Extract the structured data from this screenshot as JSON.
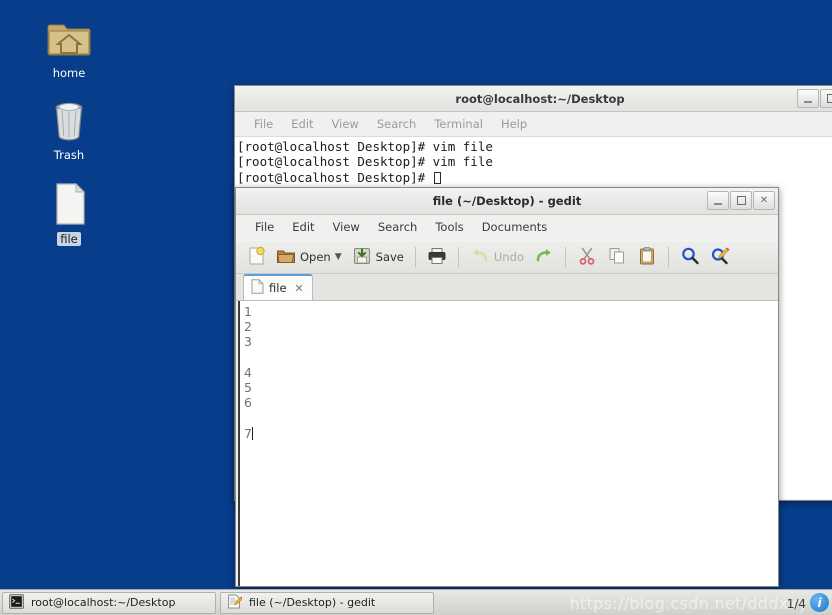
{
  "desktop": {
    "background_color": "#083d8c",
    "icons": [
      {
        "name": "home",
        "label": "home",
        "icon": "folder-home-icon",
        "selected": false
      },
      {
        "name": "trash",
        "label": "Trash",
        "icon": "trash-can-icon",
        "selected": false
      },
      {
        "name": "file",
        "label": "file",
        "icon": "text-file-icon",
        "selected": true
      }
    ]
  },
  "terminal": {
    "title": "root@localhost:~/Desktop",
    "menu": [
      "File",
      "Edit",
      "View",
      "Search",
      "Terminal",
      "Help"
    ],
    "window_buttons": [
      "minimize",
      "maximize"
    ],
    "lines": [
      "[root@localhost Desktop]# vim file",
      "[root@localhost Desktop]# vim file",
      "[root@localhost Desktop]# "
    ],
    "prompt_cursor": true
  },
  "gedit": {
    "title": "file (~/Desktop) - gedit",
    "menu": [
      "File",
      "Edit",
      "View",
      "Search",
      "Tools",
      "Documents"
    ],
    "window_buttons": [
      "minimize",
      "maximize",
      "close"
    ],
    "toolbar": [
      {
        "name": "new-document-button",
        "label": "",
        "icon": "new-document-icon",
        "disabled": false
      },
      {
        "name": "open-button",
        "label": "Open",
        "icon": "open-folder-icon",
        "disabled": false,
        "dropdown": true
      },
      {
        "name": "save-button",
        "label": "Save",
        "icon": "save-disk-icon",
        "disabled": false
      },
      {
        "name": "print-button",
        "label": "",
        "icon": "printer-icon",
        "disabled": false
      },
      {
        "name": "undo-button",
        "label": "Undo",
        "icon": "undo-arrow-icon",
        "disabled": true
      },
      {
        "name": "redo-button",
        "label": "",
        "icon": "redo-arrow-icon",
        "disabled": false
      },
      {
        "name": "cut-button",
        "label": "",
        "icon": "scissors-icon",
        "disabled": false
      },
      {
        "name": "copy-button",
        "label": "",
        "icon": "copy-icon",
        "disabled": false
      },
      {
        "name": "paste-button",
        "label": "",
        "icon": "clipboard-icon",
        "disabled": false
      },
      {
        "name": "find-button",
        "label": "",
        "icon": "magnifier-icon",
        "disabled": false
      },
      {
        "name": "replace-button",
        "label": "",
        "icon": "find-replace-icon",
        "disabled": false
      }
    ],
    "tabs": [
      {
        "label": "file",
        "icon": "document-icon",
        "active": true,
        "close_glyph": "✕"
      }
    ],
    "document": {
      "lines": [
        "1",
        "2",
        "3",
        "",
        "4",
        "5",
        "6",
        "",
        "7"
      ],
      "cursor_line_index": 8
    }
  },
  "taskbar": {
    "buttons": [
      {
        "name": "taskbar-terminal",
        "label": "root@localhost:~/Desktop",
        "icon": "terminal-icon",
        "active": false
      },
      {
        "name": "taskbar-gedit",
        "label": "file (~/Desktop) - gedit",
        "icon": "gedit-icon",
        "active": true
      }
    ]
  },
  "watermark": {
    "text": "https://blog.csdn.net/dddxxy",
    "page_indicator": "1/4",
    "badge_glyph": "i"
  }
}
